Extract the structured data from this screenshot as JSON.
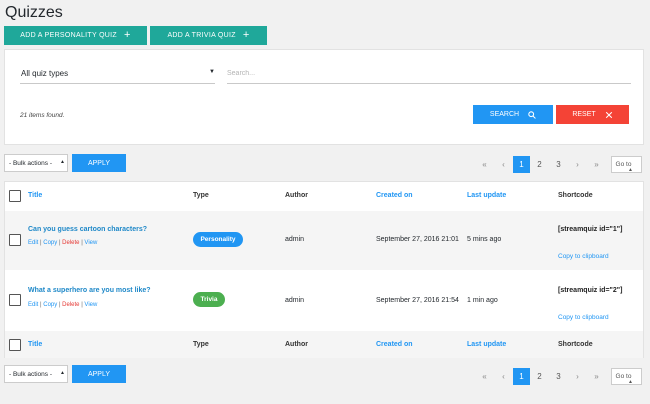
{
  "page": {
    "title": "Quizzes"
  },
  "top_buttons": {
    "personality": "ADD A PERSONALITY QUIZ",
    "trivia": "ADD A TRIVIA QUIZ"
  },
  "filter": {
    "type_value": "All quiz types",
    "search_placeholder": "Search...",
    "found_text": "21 items found.",
    "search_label": "SEARCH",
    "reset_label": "RESET"
  },
  "bulk": {
    "select_value": "- Bulk actions -",
    "apply_label": "APPLY"
  },
  "pager": {
    "first": "«",
    "prev": "‹",
    "pages": [
      "1",
      "2",
      "3"
    ],
    "current": "1",
    "next": "›",
    "last": "»",
    "goto_label": "Go to"
  },
  "columns": {
    "title": "Title",
    "type": "Type",
    "author": "Author",
    "created": "Created on",
    "updated": "Last update",
    "shortcode": "Shortcode"
  },
  "rows": [
    {
      "title": "Can you guess cartoon characters?",
      "actions": {
        "edit": "Edit",
        "copy": "Copy",
        "delete": "Delete",
        "view": "View",
        "sep": "|"
      },
      "type": "Personality",
      "author": "admin",
      "created": "September 27, 2016 21:01",
      "updated": "5 mins ago",
      "shortcode": "[streamquiz id=\"1\"]",
      "copy_label": "Copy to clipboard"
    },
    {
      "title": "What a superhero are you most like?",
      "actions": {
        "edit": "Edit",
        "copy": "Copy",
        "delete": "Delete",
        "view": "View",
        "sep": "|"
      },
      "type": "Trivia",
      "author": "admin",
      "created": "September 27, 2016 21:54",
      "updated": "1 min ago",
      "shortcode": "[streamquiz id=\"2\"]",
      "copy_label": "Copy to clipboard"
    }
  ],
  "colors": {
    "teal": "#1fa89a",
    "blue": "#2196f3",
    "red": "#f44336",
    "green": "#4caf50"
  }
}
